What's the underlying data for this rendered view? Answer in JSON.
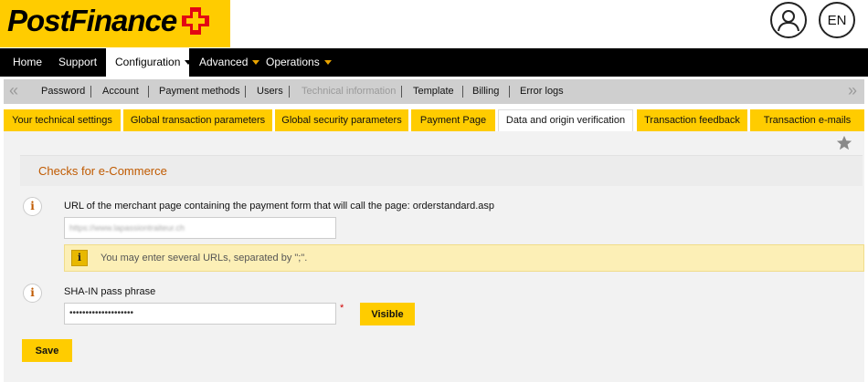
{
  "header": {
    "logo_text": "PostFinance",
    "brand_color": "#ffcc00",
    "cross_color": "#e30613",
    "account_icon": "user-icon",
    "language": "EN"
  },
  "main_nav": [
    {
      "label": "Home",
      "has_dropdown": false
    },
    {
      "label": "Support",
      "has_dropdown": false
    },
    {
      "label": "Configuration",
      "has_dropdown": true,
      "active": true
    },
    {
      "label": "Advanced",
      "has_dropdown": true
    },
    {
      "label": "Operations",
      "has_dropdown": true
    }
  ],
  "sub_nav": {
    "left_arrow": "«",
    "right_arrow": "»",
    "items": [
      {
        "label": "Password"
      },
      {
        "label": "Account"
      },
      {
        "label": "Payment methods"
      },
      {
        "label": "Users"
      },
      {
        "label": "Technical information",
        "disabled": true
      },
      {
        "label": "Template"
      },
      {
        "label": "Billing"
      },
      {
        "label": "Error logs"
      }
    ]
  },
  "tabs": [
    {
      "label": "Your technical settings"
    },
    {
      "label": "Global transaction parameters"
    },
    {
      "label": "Global security parameters"
    },
    {
      "label": "Payment Page"
    },
    {
      "label": "Data and origin verification",
      "active": true
    },
    {
      "label": "Transaction feedback"
    },
    {
      "label": "Transaction e-mails"
    }
  ],
  "section": {
    "title": "Checks for e-Commerce",
    "favorite_icon": "star-icon"
  },
  "url_field": {
    "label": "URL of the merchant page containing the payment form that will call the page: orderstandard.asp",
    "value": "https://www.lapassiontraiteur.ch"
  },
  "notice": {
    "text": "You may enter several URLs, separated by \";\"."
  },
  "sha_field": {
    "label": "SHA-IN pass phrase",
    "value": "••••••••••••••••••••",
    "required_mark": "*",
    "visible_button": "Visible"
  },
  "save_button": "Save"
}
